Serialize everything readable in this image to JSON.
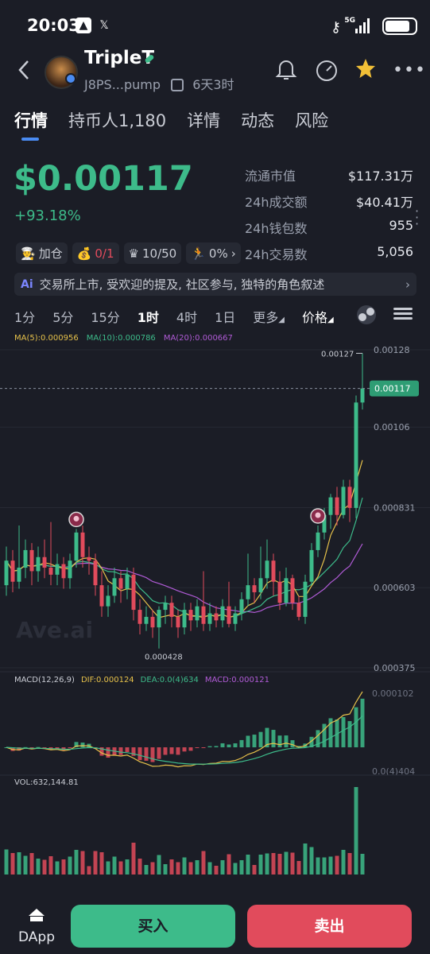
{
  "status_bar": {
    "time": "20:03",
    "network": "5G"
  },
  "header": {
    "title": "TripleT",
    "address": "J8PS...pump",
    "age": "6天3时"
  },
  "tabs": [
    {
      "label": "行情"
    },
    {
      "label": "持币人1,180"
    },
    {
      "label": "详情"
    },
    {
      "label": "动态"
    },
    {
      "label": "风险"
    }
  ],
  "price": {
    "value": "$0.00117",
    "change": "+93.18%"
  },
  "stats": [
    {
      "label": "流通市值",
      "value": "$117.31万"
    },
    {
      "label": "24h成交额",
      "value": "$40.41万"
    },
    {
      "label": "24h钱包数",
      "value": "955"
    },
    {
      "label": "24h交易数",
      "value": "5,056"
    }
  ],
  "chips": [
    {
      "icon": "cook-icon",
      "label": "加仓"
    },
    {
      "icon": "money-bag-icon",
      "label": "0/1"
    },
    {
      "icon": "crown-icon",
      "label": "10/50"
    },
    {
      "icon": "runner-icon",
      "label": "0%"
    }
  ],
  "banner": {
    "badge": "Ai",
    "text": "交易所上市, 受欢迎的提及, 社区参与, 独特的角色叙述"
  },
  "intervals": [
    "1分",
    "5分",
    "15分",
    "1时",
    "4时",
    "1日",
    "更多",
    "价格"
  ],
  "selected_interval": "1时",
  "legends": {
    "ma5": "MA(5):0.000956",
    "ma10": "MA(10):0.000786",
    "ma20": "MA(20):0.000667",
    "macd_title": "MACD(12,26,9)",
    "dif": "DIF:0.000124",
    "dea": "DEA:0.0(4)634",
    "macd": "MACD:0.000121",
    "vol": "VOL:632,144.81"
  },
  "chart_data": {
    "type": "candlestick",
    "y_axis_labels": [
      "0.00128",
      "0.00106",
      "0.000831",
      "0.000603",
      "0.000375"
    ],
    "current_price_label": "0.00117",
    "high_label": "0.00127",
    "low_label": "0.000428",
    "macd_axis_labels": [
      "0.000102",
      "0.0(4)404"
    ],
    "watermark": "Ave.ai",
    "colors": {
      "up": "#3dbb8a",
      "down": "#e14b5c",
      "ma5": "#e6c14a",
      "ma10": "#3dbb8a",
      "ma20": "#b05bd6"
    },
    "candles": [
      {
        "o": 0.00061,
        "c": 0.00068,
        "h": 0.00072,
        "l": 0.00058
      },
      {
        "o": 0.00068,
        "c": 0.00062,
        "h": 0.00071,
        "l": 0.00059
      },
      {
        "o": 0.00062,
        "c": 0.00066,
        "h": 0.00078,
        "l": 0.0006
      },
      {
        "o": 0.00066,
        "c": 0.00071,
        "h": 0.00074,
        "l": 0.00063
      },
      {
        "o": 0.00071,
        "c": 0.00065,
        "h": 0.00073,
        "l": 0.00061
      },
      {
        "o": 0.00065,
        "c": 0.00069,
        "h": 0.00072,
        "l": 0.00062
      },
      {
        "o": 0.00069,
        "c": 0.00066,
        "h": 0.00074,
        "l": 0.00063
      },
      {
        "o": 0.00066,
        "c": 0.00064,
        "h": 0.00079,
        "l": 0.00061
      },
      {
        "o": 0.00064,
        "c": 0.00067,
        "h": 0.0007,
        "l": 0.00061
      },
      {
        "o": 0.00067,
        "c": 0.00063,
        "h": 0.00069,
        "l": 0.0006
      },
      {
        "o": 0.00063,
        "c": 0.00068,
        "h": 0.0007,
        "l": 0.0006
      },
      {
        "o": 0.00068,
        "c": 0.00076,
        "h": 0.00077,
        "l": 0.00066
      },
      {
        "o": 0.00076,
        "c": 0.00069,
        "h": 0.00078,
        "l": 0.00066
      },
      {
        "o": 0.00069,
        "c": 0.00068,
        "h": 0.00072,
        "l": 0.00064
      },
      {
        "o": 0.00068,
        "c": 0.00061,
        "h": 0.0007,
        "l": 0.00058
      },
      {
        "o": 0.00061,
        "c": 0.00055,
        "h": 0.00065,
        "l": 0.00052
      },
      {
        "o": 0.00055,
        "c": 0.00058,
        "h": 0.00061,
        "l": 0.00052
      },
      {
        "o": 0.00058,
        "c": 0.00063,
        "h": 0.00066,
        "l": 0.00056
      },
      {
        "o": 0.00063,
        "c": 0.0006,
        "h": 0.00065,
        "l": 0.00056
      },
      {
        "o": 0.0006,
        "c": 0.00064,
        "h": 0.00066,
        "l": 0.00057
      },
      {
        "o": 0.00064,
        "c": 0.00054,
        "h": 0.00066,
        "l": 0.00051
      },
      {
        "o": 0.00054,
        "c": 0.0005,
        "h": 0.00057,
        "l": 0.00047
      },
      {
        "o": 0.0005,
        "c": 0.00052,
        "h": 0.00055,
        "l": 0.00048
      },
      {
        "o": 0.00052,
        "c": 0.00049,
        "h": 0.00054,
        "l": 0.00046
      },
      {
        "o": 0.00049,
        "c": 0.00054,
        "h": 0.00055,
        "l": 0.00043
      },
      {
        "o": 0.00054,
        "c": 0.00056,
        "h": 0.00058,
        "l": 0.0005
      },
      {
        "o": 0.00056,
        "c": 0.00052,
        "h": 0.00058,
        "l": 0.00049
      },
      {
        "o": 0.00052,
        "c": 0.00049,
        "h": 0.00054,
        "l": 0.00046
      },
      {
        "o": 0.00049,
        "c": 0.00054,
        "h": 0.00056,
        "l": 0.00047
      },
      {
        "o": 0.00054,
        "c": 0.00051,
        "h": 0.00056,
        "l": 0.00048
      },
      {
        "o": 0.00051,
        "c": 0.00055,
        "h": 0.00057,
        "l": 0.00049
      },
      {
        "o": 0.00055,
        "c": 0.0005,
        "h": 0.00065,
        "l": 0.00048
      },
      {
        "o": 0.0005,
        "c": 0.00053,
        "h": 0.00056,
        "l": 0.00048
      },
      {
        "o": 0.00053,
        "c": 0.00051,
        "h": 0.00055,
        "l": 0.00049
      },
      {
        "o": 0.00051,
        "c": 0.00055,
        "h": 0.00057,
        "l": 0.00049
      },
      {
        "o": 0.00055,
        "c": 0.0005,
        "h": 0.00062,
        "l": 0.00049
      },
      {
        "o": 0.0005,
        "c": 0.00053,
        "h": 0.00055,
        "l": 0.00048
      },
      {
        "o": 0.00053,
        "c": 0.00057,
        "h": 0.00059,
        "l": 0.00051
      },
      {
        "o": 0.00057,
        "c": 0.00061,
        "h": 0.0007,
        "l": 0.00055
      },
      {
        "o": 0.00061,
        "c": 0.00059,
        "h": 0.00063,
        "l": 0.00056
      },
      {
        "o": 0.00059,
        "c": 0.00063,
        "h": 0.00072,
        "l": 0.00057
      },
      {
        "o": 0.00063,
        "c": 0.00068,
        "h": 0.00074,
        "l": 0.0006
      },
      {
        "o": 0.00068,
        "c": 0.00062,
        "h": 0.0007,
        "l": 0.00058
      },
      {
        "o": 0.00062,
        "c": 0.00056,
        "h": 0.00065,
        "l": 0.00054
      },
      {
        "o": 0.00056,
        "c": 0.00063,
        "h": 0.00066,
        "l": 0.00055
      },
      {
        "o": 0.00063,
        "c": 0.00056,
        "h": 0.00064,
        "l": 0.00054
      },
      {
        "o": 0.00056,
        "c": 0.00052,
        "h": 0.00058,
        "l": 0.00051
      },
      {
        "o": 0.00052,
        "c": 0.00062,
        "h": 0.00064,
        "l": 0.0005
      },
      {
        "o": 0.00062,
        "c": 0.00071,
        "h": 0.00073,
        "l": 0.00061
      },
      {
        "o": 0.00071,
        "c": 0.00076,
        "h": 0.00078,
        "l": 0.00069
      },
      {
        "o": 0.00076,
        "c": 0.00081,
        "h": 0.00083,
        "l": 0.00074
      },
      {
        "o": 0.00081,
        "c": 0.00086,
        "h": 0.00087,
        "l": 0.00077
      },
      {
        "o": 0.00086,
        "c": 0.00081,
        "h": 0.00089,
        "l": 0.00078
      },
      {
        "o": 0.00081,
        "c": 0.00089,
        "h": 0.00091,
        "l": 0.0008
      },
      {
        "o": 0.00089,
        "c": 0.00083,
        "h": 0.00091,
        "l": 0.00079
      },
      {
        "o": 0.00083,
        "c": 0.00113,
        "h": 0.00115,
        "l": 0.0008
      },
      {
        "o": 0.00113,
        "c": 0.00117,
        "h": 0.00127,
        "l": 0.00111
      }
    ],
    "markers": [
      {
        "index": 11,
        "label": "cook-icon"
      },
      {
        "index": 49,
        "label": "cook-icon"
      }
    ]
  },
  "bottom_bar": {
    "dapp_label": "DApp",
    "buy_label": "买入",
    "sell_label": "卖出"
  }
}
